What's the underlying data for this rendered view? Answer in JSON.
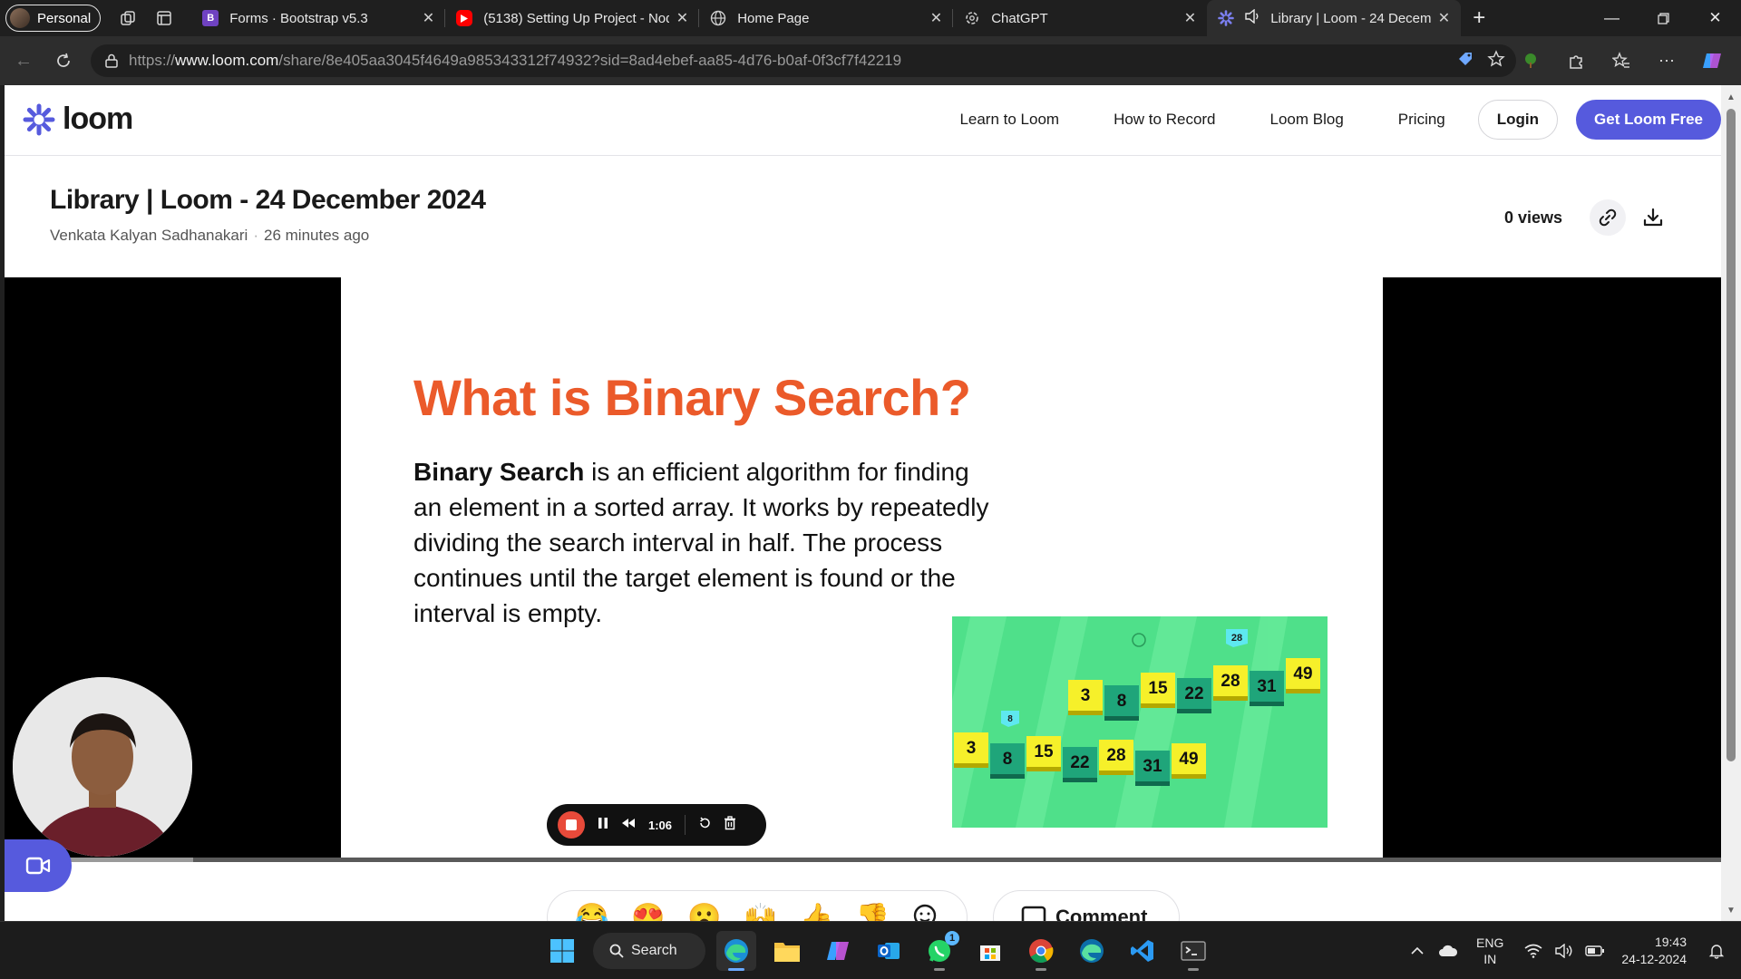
{
  "browser": {
    "profile_label": "Personal",
    "tabs": [
      {
        "title": "Forms · Bootstrap v5.3",
        "favicon": "bootstrap-icon",
        "favicon_letter": "B",
        "favicon_color": "#6f42c1"
      },
      {
        "title": "(5138) Setting Up Project - Nod",
        "favicon": "youtube-icon",
        "favicon_color": "#ff0000"
      },
      {
        "title": "Home Page",
        "favicon": "globe-icon",
        "favicon_color": "#cfcfcf"
      },
      {
        "title": "ChatGPT",
        "favicon": "chatgpt-icon",
        "favicon_color": "#cfcfcf"
      },
      {
        "title": "Library | Loom - 24 Decem",
        "favicon": "loom-icon",
        "favicon_color": "#565add",
        "active": true,
        "audio": true
      }
    ],
    "url_prefix": "https://",
    "url_host": "www.loom.com",
    "url_path": "/share/8e405aa3045f4649a985343312f74932?sid=8ad4ebef-aa85-4d76-b0af-0f3cf7f42219"
  },
  "site": {
    "logo_text": "loom",
    "brand_color": "#565add",
    "nav": [
      "Learn to Loom",
      "How to Record",
      "Loom Blog",
      "Pricing"
    ],
    "login_label": "Login",
    "cta_label": "Get Loom Free"
  },
  "video": {
    "title": "Library | Loom - 24 December 2024",
    "author": "Venkata Kalyan Sadhanakari",
    "time_ago": "26 minutes ago",
    "views": "0 views",
    "slide": {
      "heading": "What is Binary Search?",
      "body_bold": "Binary Search",
      "body_rest": " is an efficient algorithm for finding an element in a sorted array. It works by repeatedly dividing the search interval in half. The process continues until the target element is found or the interval is empty.",
      "heading_color": "#eb5a2a",
      "array_top": [
        "3",
        "8",
        "15",
        "22",
        "28",
        "31",
        "49"
      ],
      "array_bottom": [
        "3",
        "8",
        "15",
        "22",
        "28",
        "31",
        "49"
      ],
      "marker_top": "28",
      "marker_bottom": "8"
    },
    "recording_time": "1:06",
    "played_fraction": 0.015,
    "buffered_fraction": 0.11
  },
  "engagement": {
    "reactions": [
      "😂",
      "😍",
      "😮",
      "🙌",
      "👍",
      "👎"
    ],
    "comment_label": "Comment"
  },
  "taskbar": {
    "search_label": "Search",
    "whatsapp_badge": "1",
    "language_line1": "ENG",
    "language_line2": "IN",
    "time": "19:43",
    "date": "24-12-2024"
  }
}
